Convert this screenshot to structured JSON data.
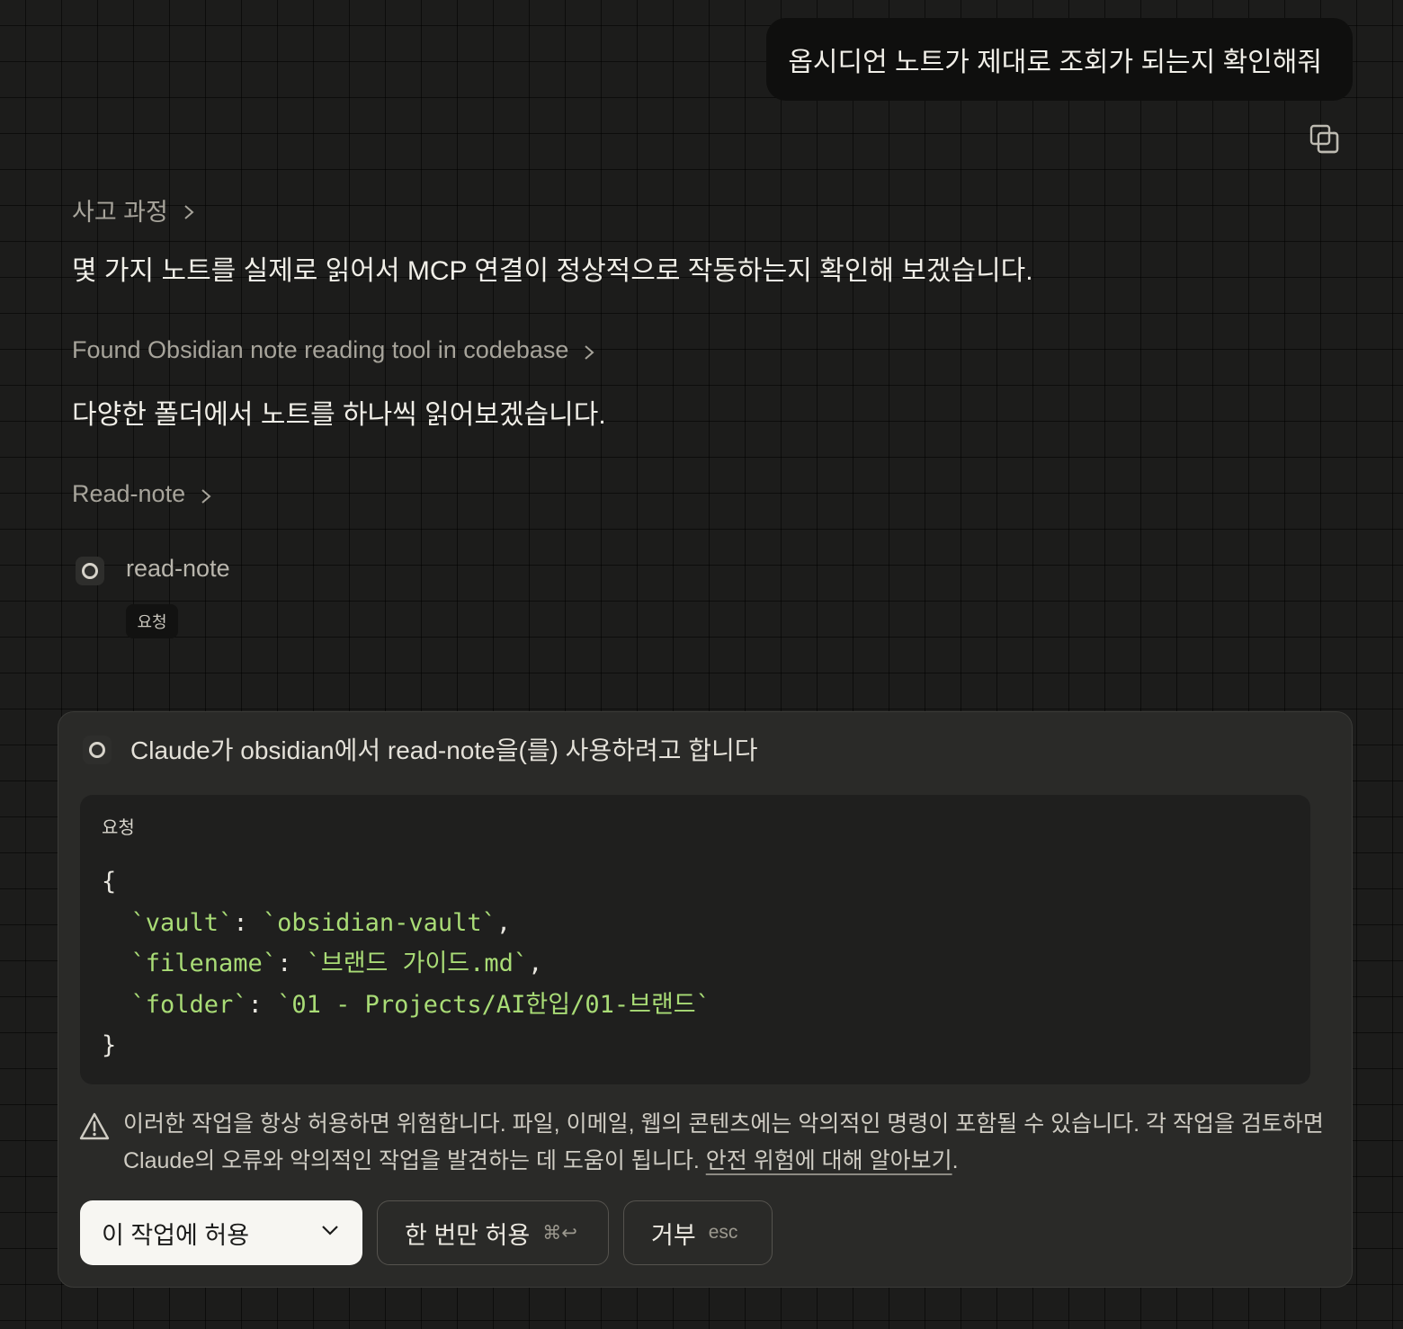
{
  "user_message": {
    "text": "옵시디언 노트가 제대로 조회가 되는지 확인해줘"
  },
  "copy_icon": "copy-icon",
  "thinking": {
    "label": "사고 과정"
  },
  "assistant": {
    "paragraph_1": "몇 가지 노트를 실제로 읽어서 MCP 연결이 정상적으로 작동하는지 확인해 보겠습니다.",
    "step_label": "Found Obsidian note reading tool in codebase",
    "paragraph_2": "다양한 폴더에서 노트를 하나씩 읽어보겠습니다.",
    "tool_section_label": "Read-note"
  },
  "tool_call": {
    "name": "read-note",
    "tag": "요청"
  },
  "permission": {
    "title": "Claude가 obsidian에서 read-note을(를) 사용하려고 합니다",
    "request_label": "요청",
    "request": {
      "open": "{",
      "close": "}",
      "params": [
        {
          "key": "`vault`",
          "value": "`obsidian-vault`"
        },
        {
          "key": "`filename`",
          "value": "`브랜드 가이드.md`"
        },
        {
          "key": "`folder`",
          "value": "`01 - Projects/AI한입/01-브랜드`"
        }
      ]
    },
    "warning_text": "이러한 작업을 항상 허용하면 위험합니다. 파일, 이메일, 웹의 콘텐츠에는 악의적인 명령이 포함될 수 있습니다. 각 작업을 검토하면 Claude의 오류와 악의적인 작업을 발견하는 데 도움이 됩니다.",
    "warning_link": "안전 위험에 대해 알아보기",
    "warning_end": ".",
    "buttons": {
      "allow_task": "이 작업에 허용",
      "allow_once": "한 번만 허용",
      "allow_once_shortcut": "⌘↩",
      "deny": "거부",
      "deny_shortcut": "esc"
    }
  }
}
